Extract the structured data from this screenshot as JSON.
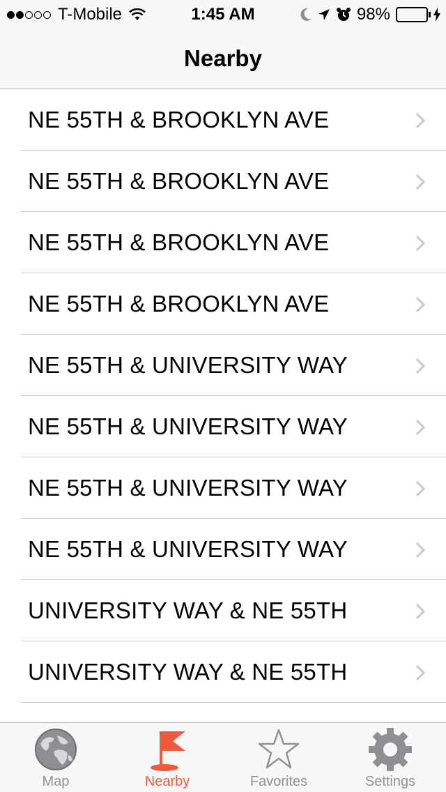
{
  "status_bar": {
    "carrier": "T-Mobile",
    "time": "1:45 AM",
    "battery": "98%",
    "battery_level": 0.98,
    "signal_bars_filled": 2,
    "signal_bars_total": 5
  },
  "navbar": {
    "title": "Nearby"
  },
  "stops": [
    {
      "label": "NE 55TH & BROOKLYN AVE"
    },
    {
      "label": "NE 55TH & BROOKLYN AVE"
    },
    {
      "label": "NE 55TH & BROOKLYN AVE"
    },
    {
      "label": "NE 55TH & BROOKLYN AVE"
    },
    {
      "label": "NE 55TH & UNIVERSITY WAY"
    },
    {
      "label": "NE 55TH & UNIVERSITY WAY"
    },
    {
      "label": "NE 55TH & UNIVERSITY WAY"
    },
    {
      "label": "NE 55TH & UNIVERSITY WAY"
    },
    {
      "label": "UNIVERSITY WAY & NE 55TH"
    },
    {
      "label": "UNIVERSITY WAY & NE 55TH"
    }
  ],
  "tabbar": {
    "tabs": [
      {
        "label": "Map",
        "icon": "globe-icon"
      },
      {
        "label": "Nearby",
        "icon": "flag-icon",
        "active": true
      },
      {
        "label": "Favorites",
        "icon": "star-icon"
      },
      {
        "label": "Settings",
        "icon": "gear-icon"
      }
    ]
  },
  "colors": {
    "accent": "#f05a3c",
    "inactive": "#929292",
    "battery": "#4cd964"
  }
}
